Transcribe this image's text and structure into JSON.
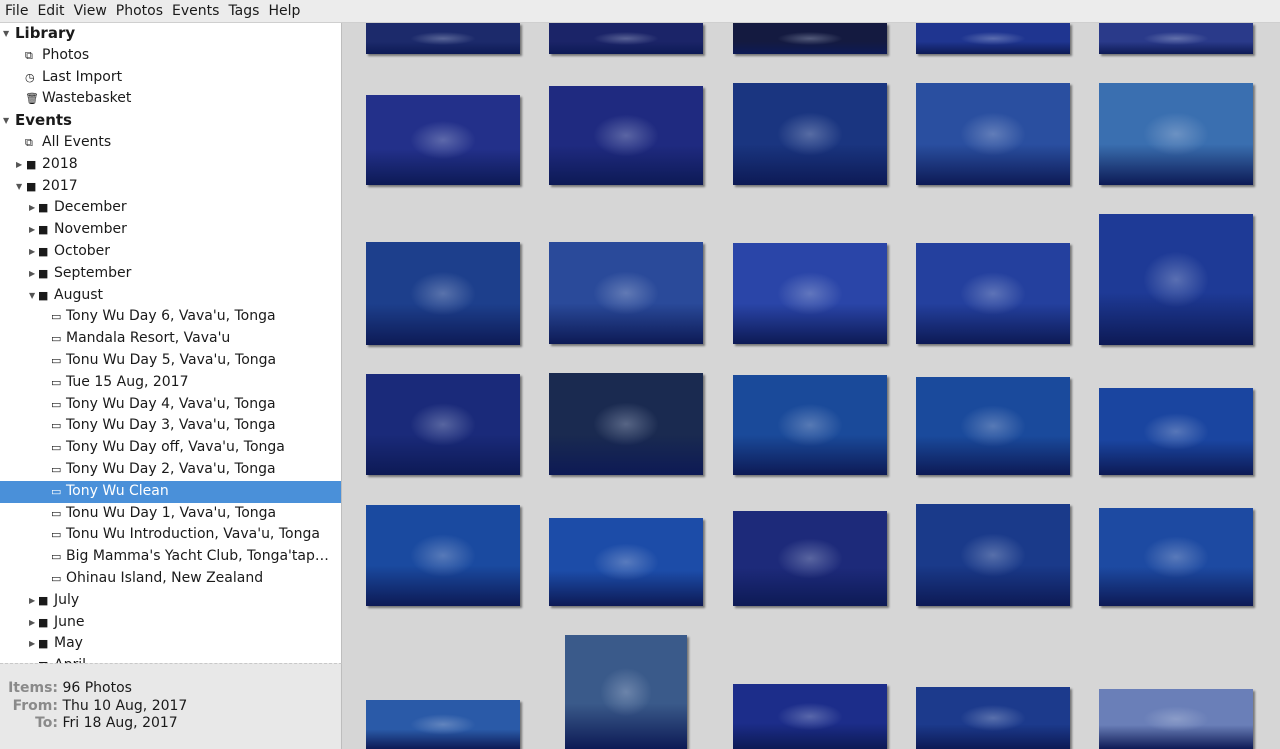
{
  "menu": [
    "File",
    "Edit",
    "View",
    "Photos",
    "Events",
    "Tags",
    "Help"
  ],
  "tree": [
    {
      "label": "Library",
      "level": 0,
      "arrow": "down",
      "bold": true
    },
    {
      "label": "Photos",
      "level": 1,
      "icon": "photos-icon",
      "glyph": "⧉"
    },
    {
      "label": "Last Import",
      "level": 1,
      "icon": "clock-icon",
      "glyph": "◷"
    },
    {
      "label": "Wastebasket",
      "level": 1,
      "icon": "trash-icon",
      "glyph": "🗑"
    },
    {
      "label": "Events",
      "level": 0,
      "arrow": "down",
      "bold": true
    },
    {
      "label": "All Events",
      "level": 1,
      "icon": "events-icon",
      "glyph": "⧉"
    },
    {
      "label": "2018",
      "level": 2,
      "arrow": "right",
      "icon": "folder-icon",
      "glyph": "■"
    },
    {
      "label": "2017",
      "level": 2,
      "arrow": "down",
      "icon": "folder-icon",
      "glyph": "■"
    },
    {
      "label": "December",
      "level": 3,
      "arrow": "right",
      "icon": "folder-icon",
      "glyph": "■"
    },
    {
      "label": "November",
      "level": 3,
      "arrow": "right",
      "icon": "folder-icon",
      "glyph": "■"
    },
    {
      "label": "October",
      "level": 3,
      "arrow": "right",
      "icon": "folder-icon",
      "glyph": "■"
    },
    {
      "label": "September",
      "level": 3,
      "arrow": "right",
      "icon": "folder-icon",
      "glyph": "■"
    },
    {
      "label": "August",
      "level": 3,
      "arrow": "down",
      "icon": "folder-icon",
      "glyph": "■"
    },
    {
      "label": "Tony Wu Day 6, Vava'u, Tonga",
      "level": 4,
      "icon": "event-icon",
      "glyph": "▭"
    },
    {
      "label": "Mandala Resort, Vava'u",
      "level": 4,
      "icon": "event-icon",
      "glyph": "▭"
    },
    {
      "label": "Tonu Wu Day 5, Vava'u, Tonga",
      "level": 4,
      "icon": "event-icon",
      "glyph": "▭"
    },
    {
      "label": "Tue 15 Aug, 2017",
      "level": 4,
      "icon": "event-icon",
      "glyph": "▭"
    },
    {
      "label": "Tony Wu Day 4, Vava'u, Tonga",
      "level": 4,
      "icon": "event-icon",
      "glyph": "▭"
    },
    {
      "label": "Tony Wu Day 3, Vava'u, Tonga",
      "level": 4,
      "icon": "event-icon",
      "glyph": "▭"
    },
    {
      "label": "Tony Wu Day off, Vava'u, Tonga",
      "level": 4,
      "icon": "event-icon",
      "glyph": "▭"
    },
    {
      "label": "Tony Wu Day 2, Vava'u, Tonga",
      "level": 4,
      "icon": "event-icon",
      "glyph": "▭"
    },
    {
      "label": "Tony Wu Clean",
      "level": 4,
      "icon": "event-icon",
      "glyph": "▭",
      "selected": true
    },
    {
      "label": "Tonu Wu Day 1, Vava'u, Tonga",
      "level": 4,
      "icon": "event-icon",
      "glyph": "▭"
    },
    {
      "label": "Tonu Wu Introduction, Vava'u, Tonga",
      "level": 4,
      "icon": "event-icon",
      "glyph": "▭"
    },
    {
      "label": "Big Mamma's Yacht Club, Tonga'tap…",
      "level": 4,
      "icon": "event-icon",
      "glyph": "▭"
    },
    {
      "label": "Ohinau Island, New Zealand",
      "level": 4,
      "icon": "event-icon",
      "glyph": "▭"
    },
    {
      "label": "July",
      "level": 3,
      "arrow": "right",
      "icon": "folder-icon",
      "glyph": "■"
    },
    {
      "label": "June",
      "level": 3,
      "arrow": "right",
      "icon": "folder-icon",
      "glyph": "■"
    },
    {
      "label": "May",
      "level": 3,
      "arrow": "right",
      "icon": "folder-icon",
      "glyph": "■"
    },
    {
      "label": "April",
      "level": 3,
      "arrow": "right",
      "icon": "folder-icon",
      "glyph": "■"
    }
  ],
  "info": {
    "items_label": "Items:",
    "items": "96 Photos",
    "from_label": "From:",
    "from": "Thu 10 Aug, 2017",
    "to_label": "To:",
    "to": "Fri 18 Aug, 2017"
  },
  "photo_colors": [
    "#1c2a6b",
    "#1b2468",
    "#141a40",
    "#1f3590",
    "#2a3a8a",
    "#23308a",
    "#1f2a80",
    "#1a3580",
    "#2a4fa0",
    "#3a6fb0",
    "#1d3f8c",
    "#2a4a9a",
    "#2a45a8",
    "#24409e",
    "#1e3a96",
    "#1a2a7a",
    "#1a2a50",
    "#1a4a9a",
    "#1a4a9c",
    "#1a45a0",
    "#1a4aa0",
    "#1c4ca8",
    "#1d2a7a",
    "#1a3a8a",
    "#1d4aa2",
    "#2a5aa8",
    "#3a5a8a",
    "#1c2d8a",
    "#1c3a8c",
    "#6a7fb8"
  ]
}
